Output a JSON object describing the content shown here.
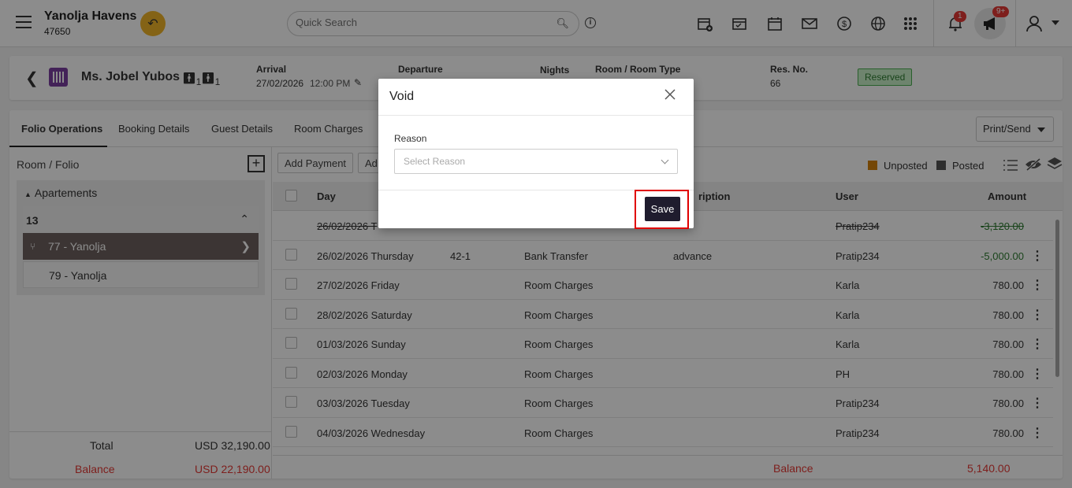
{
  "topbar": {
    "hotel_name": "Yanolja Havens",
    "hotel_id": "47650",
    "search_placeholder": "Quick Search",
    "notif_count": "1",
    "announce_count": "9+"
  },
  "reservation": {
    "guest_name": "Ms. Jobel Yubos",
    "adults": "1",
    "children": "1",
    "arrival_label": "Arrival",
    "arrival_date": "27/02/2026",
    "arrival_time": "12:00 PM",
    "departure_label": "Departure",
    "nights_label": "Nights",
    "room_label": "Room / Room Type",
    "resno_label": "Res. No.",
    "resno_value": "66",
    "status": "Reserved"
  },
  "tabs": [
    "Folio Operations",
    "Booking Details",
    "Guest Details",
    "Room Charges"
  ],
  "print_send": "Print/Send",
  "left": {
    "room_folio_label": "Room / Folio",
    "group_label": "Apartements",
    "room_number": "13",
    "folios": [
      "77 - Yanolja",
      "79 - Yanolja"
    ],
    "total_label": "Total",
    "total_value": "USD 32,190.00",
    "balance_label": "Balance",
    "balance_value": "USD 22,190.00"
  },
  "actions": {
    "add_payment": "Add Payment",
    "add_other": "Ad"
  },
  "legend": {
    "unposted": "Unposted",
    "posted": "Posted",
    "unposted_color": "#d4820a",
    "posted_color": "#555555"
  },
  "columns": {
    "day": "Day",
    "description": "ription",
    "user": "User",
    "amount": "Amount"
  },
  "rows": [
    {
      "day": "26/02/2026 T",
      "ref": "",
      "type": "",
      "desc": "",
      "user": "Pratip234",
      "amount": "-3,120.00"
    },
    {
      "day": "26/02/2026 Thursday",
      "ref": "42-1",
      "type": "Bank Transfer",
      "desc": "advance",
      "user": "Pratip234",
      "amount": "-5,000.00"
    },
    {
      "day": "27/02/2026 Friday",
      "ref": "",
      "type": "Room Charges",
      "desc": "",
      "user": "Karla",
      "amount": "780.00"
    },
    {
      "day": "28/02/2026 Saturday",
      "ref": "",
      "type": "Room Charges",
      "desc": "",
      "user": "Karla",
      "amount": "780.00"
    },
    {
      "day": "01/03/2026 Sunday",
      "ref": "",
      "type": "Room Charges",
      "desc": "",
      "user": "Karla",
      "amount": "780.00"
    },
    {
      "day": "02/03/2026 Monday",
      "ref": "",
      "type": "Room Charges",
      "desc": "",
      "user": "PH",
      "amount": "780.00"
    },
    {
      "day": "03/03/2026 Tuesday",
      "ref": "",
      "type": "Room Charges",
      "desc": "",
      "user": "Pratip234",
      "amount": "780.00"
    },
    {
      "day": "04/03/2026 Wednesday",
      "ref": "",
      "type": "Room Charges",
      "desc": "",
      "user": "Pratip234",
      "amount": "780.00"
    }
  ],
  "footer": {
    "balance_label": "Balance",
    "balance_value": "5,140.00"
  },
  "modal": {
    "title": "Void",
    "reason_label": "Reason",
    "reason_placeholder": "Select Reason",
    "save_label": "Save"
  }
}
